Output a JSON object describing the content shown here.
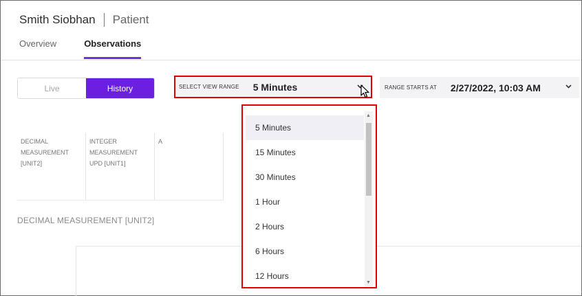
{
  "header": {
    "patient_name": "Smith Siobhan",
    "patient_role": "Patient"
  },
  "tabs": [
    {
      "label": "Overview",
      "active": false
    },
    {
      "label": "Observations",
      "active": true
    }
  ],
  "mode_toggle": {
    "live_label": "Live",
    "history_label": "History",
    "selected": "History"
  },
  "view_range": {
    "label": "SELECT VIEW RANGE",
    "value": "5 Minutes"
  },
  "range_start": {
    "label": "RANGE STARTS AT",
    "value": "2/27/2022, 10:03 AM"
  },
  "columns": [
    {
      "line1": "DECIMAL",
      "line2": "MEASUREMENT",
      "line3": "[UNIT2]"
    },
    {
      "line1": "INTEGER",
      "line2": "MEASUREMENT",
      "line3": "UPD [UNIT1]"
    },
    {
      "line1": "A",
      "line2": "",
      "line3": ""
    }
  ],
  "section": {
    "title": "DECIMAL MEASUREMENT [UNIT2]"
  },
  "dropdown": {
    "options": [
      "5 Minutes",
      "15 Minutes",
      "30 Minutes",
      "1 Hour",
      "2 Hours",
      "6 Hours",
      "12 Hours"
    ],
    "selected": "5 Minutes"
  },
  "colors": {
    "accent": "#6b1fe0",
    "highlight_border": "#e00000"
  },
  "icons": {
    "chevron": "chevron-down-icon",
    "cursor": "mouse-pointer-icon"
  }
}
